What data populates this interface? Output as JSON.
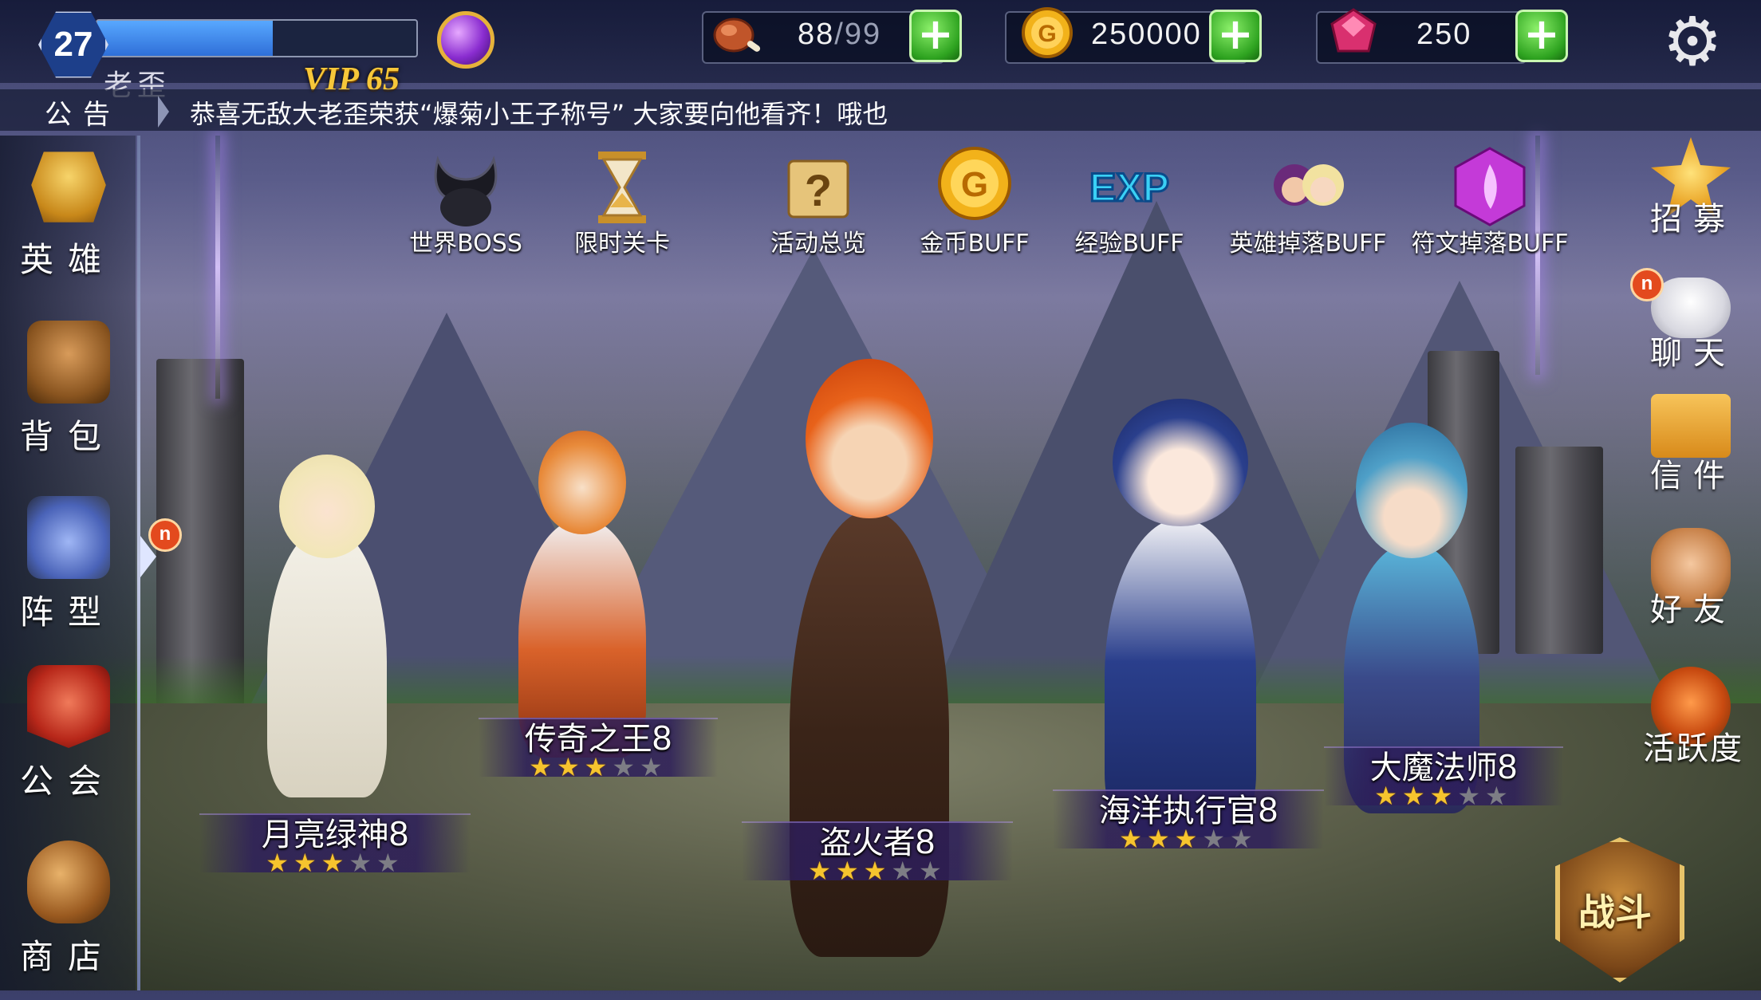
{
  "player": {
    "level": "27",
    "name": "老歪",
    "vip": "VIP 65",
    "exp_fraction": 0.55
  },
  "resources": {
    "stamina_current": "88",
    "stamina_max": "/99",
    "gold": "250000",
    "gems": "250"
  },
  "announcement": {
    "label": "公告",
    "text": "恭喜无敌大老歪荣获“爆菊小王子称号”  大家要向他看齐！哦也"
  },
  "left_nav": [
    {
      "label": "英雄",
      "icon": "helmet-icon"
    },
    {
      "label": "背包",
      "icon": "backpack-icon"
    },
    {
      "label": "阵型",
      "icon": "formation-icon",
      "badge": "n"
    },
    {
      "label": "公会",
      "icon": "guild-banner-icon"
    },
    {
      "label": "商店",
      "icon": "money-bag-icon"
    }
  ],
  "right_nav": [
    {
      "label": "招募",
      "icon": "star-icon"
    },
    {
      "label": "聊天",
      "icon": "chat-bubble-icon",
      "badge": "n"
    },
    {
      "label": "信件",
      "icon": "envelope-icon"
    },
    {
      "label": "好友",
      "icon": "handshake-icon"
    },
    {
      "label": "活跃度",
      "icon": "activity-orb-icon"
    }
  ],
  "events": [
    {
      "label": "世界BOSS",
      "icon": "horned-helmet-icon"
    },
    {
      "label": "限时关卡",
      "icon": "hourglass-icon"
    },
    {
      "label": "活动总览",
      "icon": "scroll-question-icon"
    },
    {
      "label": "金币BUFF",
      "icon": "gold-coin-icon"
    },
    {
      "label": "经验BUFF",
      "icon": "exp-icon"
    },
    {
      "label": "英雄掉落BUFF",
      "icon": "hero-portraits-icon"
    },
    {
      "label": "符文掉落BUFF",
      "icon": "rune-gem-icon"
    }
  ],
  "heroes": [
    {
      "name": "月亮绿神",
      "level": "8",
      "stars": 3,
      "max_stars": 5,
      "color": "#e9e4d8"
    },
    {
      "name": "传奇之王",
      "level": "8",
      "stars": 3,
      "max_stars": 5,
      "color": "#d9622a"
    },
    {
      "name": "盗火者",
      "level": "8",
      "stars": 3,
      "max_stars": 5,
      "color": "#e86a1e"
    },
    {
      "name": "海洋执行官",
      "level": "8",
      "stars": 3,
      "max_stars": 5,
      "color": "#2a3f8c"
    },
    {
      "name": "大魔法师",
      "level": "8",
      "stars": 3,
      "max_stars": 5,
      "color": "#4fa0c8"
    }
  ],
  "battle_button": {
    "label": "战斗"
  },
  "colors": {
    "stamina_icon": "#c0552a",
    "gold_icon": "#f2b21a",
    "gem_icon": "#d9306f",
    "plus_button": "#2ea320",
    "badge": "#e34a1e"
  }
}
